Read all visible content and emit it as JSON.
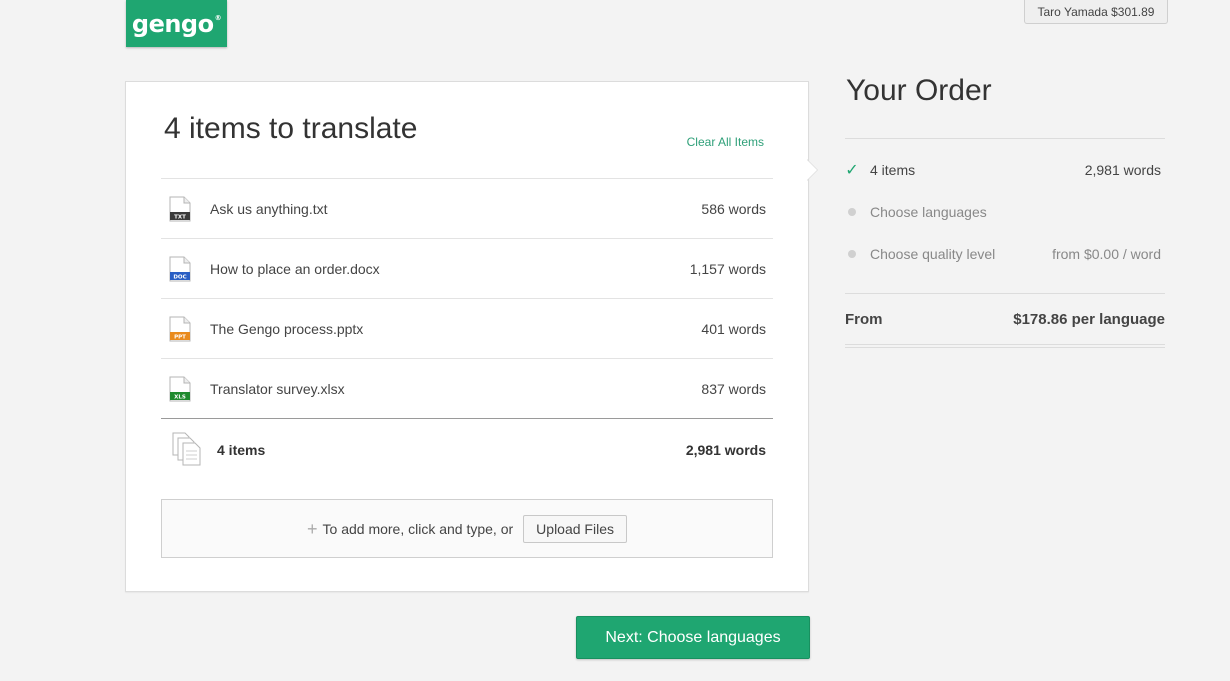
{
  "header": {
    "logo_text": "gengo",
    "logo_mark": "®",
    "account": "Taro Yamada $301.89"
  },
  "colors": {
    "brand": "#1fa671",
    "txt": "#3b3b3b",
    "doc": "#2a5fc4",
    "ppt": "#e98a1c",
    "xls": "#1f8a2e"
  },
  "card": {
    "title": "4 items to translate",
    "clear_all": "Clear All Items",
    "files": [
      {
        "name": "Ask us anything.txt",
        "words": "586 words",
        "type": "TXT",
        "icon": "txt-file-icon"
      },
      {
        "name": "How to place an order.docx",
        "words": "1,157 words",
        "type": "DOC",
        "icon": "doc-file-icon"
      },
      {
        "name": "The Gengo process.pptx",
        "words": "401 words",
        "type": "PPT",
        "icon": "ppt-file-icon"
      },
      {
        "name": "Translator survey.xlsx",
        "words": "837 words",
        "type": "XLS",
        "icon": "xls-file-icon"
      }
    ],
    "total_label": "4 items",
    "total_words": "2,981 words",
    "add_more_text": "To add more, click and type, or",
    "upload_label": "Upload Files"
  },
  "next_label": "Next: Choose languages",
  "order": {
    "title": "Your Order",
    "items_label": "4 items",
    "items_value": "2,981 words",
    "languages_label": "Choose languages",
    "quality_label": "Choose quality level",
    "quality_value": "from $0.00 / word",
    "from_label": "From",
    "from_value": "$178.86 per language"
  }
}
